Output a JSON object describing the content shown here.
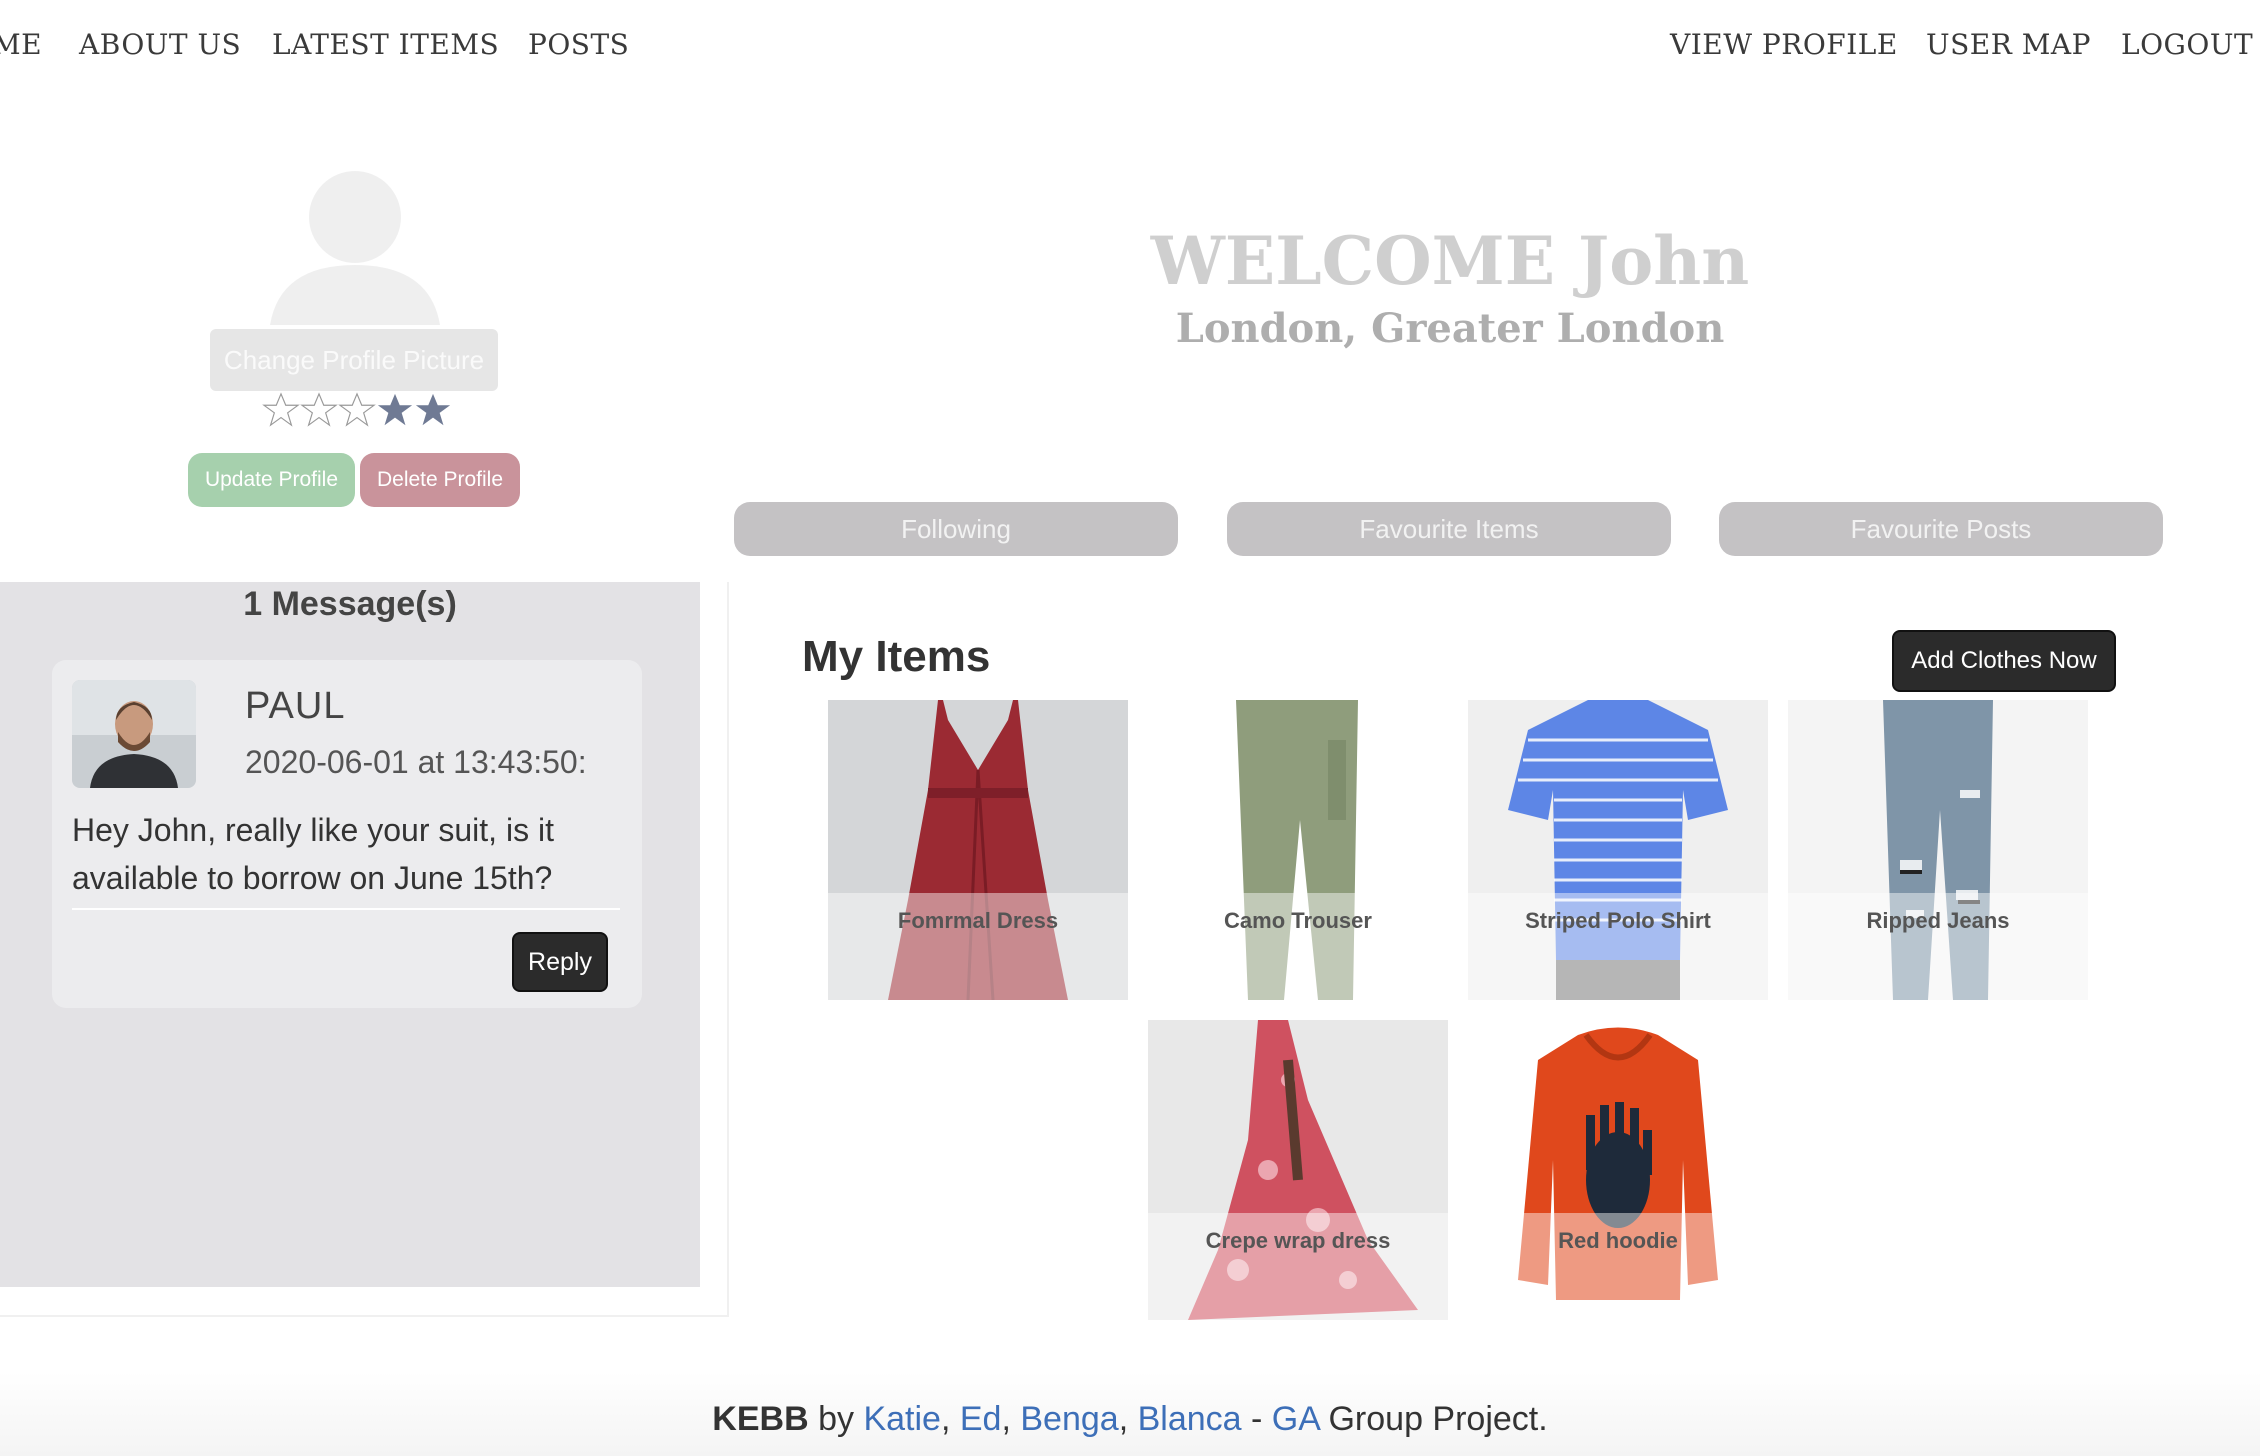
{
  "nav": {
    "left": [
      "ME",
      "ABOUT US",
      "LATEST ITEMS",
      "POSTS"
    ],
    "right": [
      "VIEW PROFILE",
      "USER MAP",
      "LOGOUT"
    ]
  },
  "profile": {
    "change_picture_label": "Change Profile Picture",
    "rating": {
      "filled": 2,
      "total": 5
    },
    "update_label": "Update Profile",
    "delete_label": "Delete Profile",
    "welcome": "WELCOME John",
    "location": "London, Greater London"
  },
  "tabs": [
    "Following",
    "Favourite Items",
    "Favourite Posts"
  ],
  "messages": {
    "count_label": "1 Message(s)",
    "items": [
      {
        "name": "PAUL",
        "timestamp": "2020-06-01 at 13:43:50:",
        "body": "Hey John, really like your suit, is it available to borrow on June 15th?",
        "reply_label": "Reply"
      }
    ]
  },
  "my_items": {
    "title": "My Items",
    "add_label": "Add Clothes Now",
    "items": [
      {
        "name": "Fomrmal Dress"
      },
      {
        "name": "Camo Trouser"
      },
      {
        "name": "Striped Polo Shirt"
      },
      {
        "name": "Ripped Jeans"
      },
      {
        "name": "Crepe wrap dress"
      },
      {
        "name": "Red hoodie"
      }
    ]
  },
  "footer": {
    "brand": "KEBB",
    "by": " by ",
    "names": [
      "Katie",
      "Ed",
      "Benga",
      "Blanca"
    ],
    "dash": " - ",
    "ga": "GA",
    "suffix": " Group Project."
  },
  "colors": {
    "update": "#a6d0ad",
    "delete": "#c9939b",
    "tab": "#c4c2c4",
    "link": "#3d6fb8",
    "star_filled": "#6f7a94"
  }
}
